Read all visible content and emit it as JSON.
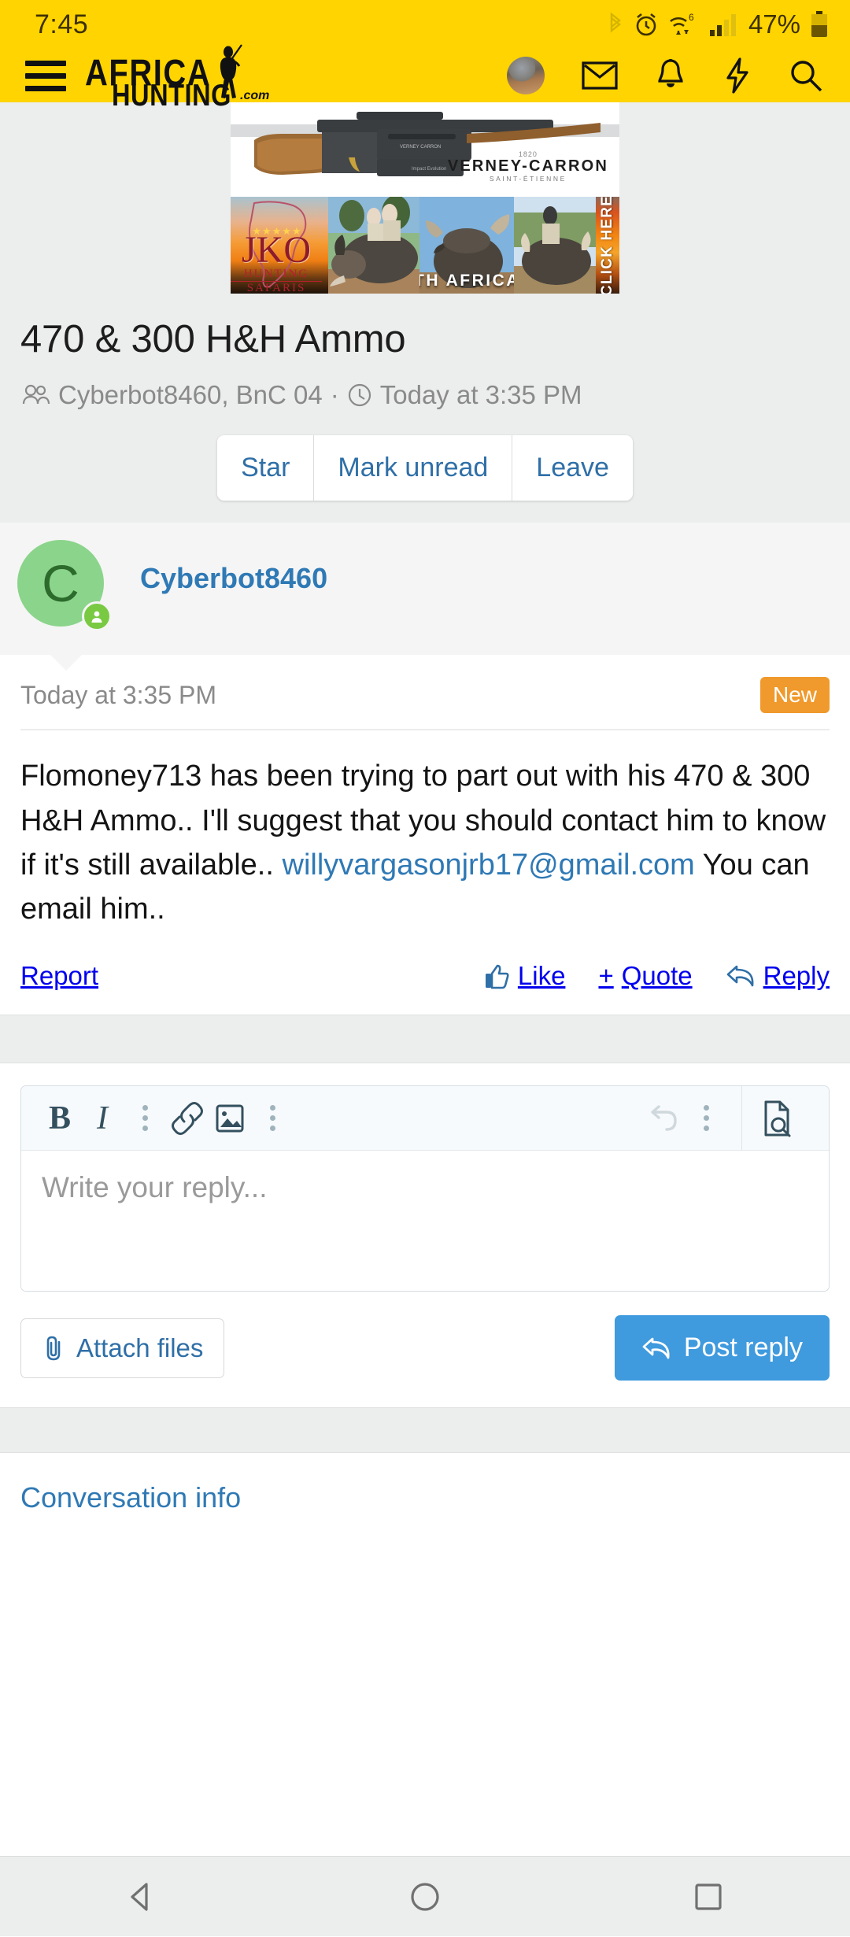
{
  "status_bar": {
    "time": "7:45",
    "battery_percent": "47%",
    "icons": [
      "bluetooth-icon",
      "alarm-icon",
      "wifi-icon",
      "signal-icon",
      "battery-icon"
    ],
    "wifi_superscript": "6"
  },
  "app_bar": {
    "menu_icon": "hamburger-menu-icon",
    "logo_line1": "AFRICA",
    "logo_line2": "HUNTING",
    "logo_suffix": ".com",
    "icons": [
      "user-avatar",
      "mail-icon",
      "bell-icon",
      "bolt-icon",
      "search-icon"
    ]
  },
  "ads": {
    "rifle_banner": {
      "brand_year": "1820",
      "brand_name": "VERNEY-CARRON",
      "brand_city": "SAINT-ÉTIENNE"
    },
    "safari_banner": {
      "logo_title": "JKO",
      "logo_sub1": "HUNTING",
      "logo_sub2": "SAFARIS",
      "stars": "★★★★★",
      "overlay_text": "SOUTH AFRICA",
      "cta": "CLICK HERE"
    }
  },
  "thread": {
    "title": "470 & 300 H&H Ammo",
    "participants": "Cyberbot8460, BnC 04",
    "separator": "·",
    "time": "Today at 3:35 PM",
    "actions": [
      {
        "label": "Star"
      },
      {
        "label": "Mark unread"
      },
      {
        "label": "Leave"
      }
    ]
  },
  "post": {
    "avatar_letter": "C",
    "author": "Cyberbot8460",
    "date": "Today at 3:35 PM",
    "badge": "New",
    "text_part1": "Flomoney713 has been trying to part out with his 470 & 300 H&H Ammo.. I'll suggest that you should contact him to know if it's still available..",
    "email_link": "willyvargasonjrb17@gmail.com",
    "text_part2": "You can email him..",
    "report_label": "Report",
    "like_label": "Like",
    "quote_label": "Quote",
    "quote_prefix": "+",
    "reply_label": "Reply"
  },
  "editor": {
    "bold_label": "B",
    "italic_label": "I",
    "toolbar_icons": [
      "bold-icon",
      "italic-icon",
      "more-options-icon",
      "link-icon",
      "image-icon",
      "more-options-icon",
      "undo-icon",
      "more-options-icon",
      "preview-icon"
    ],
    "placeholder": "Write your reply...",
    "attach_label": "Attach files",
    "post_label": "Post reply"
  },
  "footer": {
    "conversation_info": "Conversation info"
  },
  "nav_bar": {
    "back": "back-triangle-icon",
    "home": "home-circle-icon",
    "recents": "recents-square-icon"
  },
  "colors": {
    "brand_yellow": "#ffd400",
    "link_blue": "#2f79b5",
    "button_blue": "#3f9ade",
    "badge_orange": "#f0992c",
    "avatar_green": "#8bd48b"
  }
}
